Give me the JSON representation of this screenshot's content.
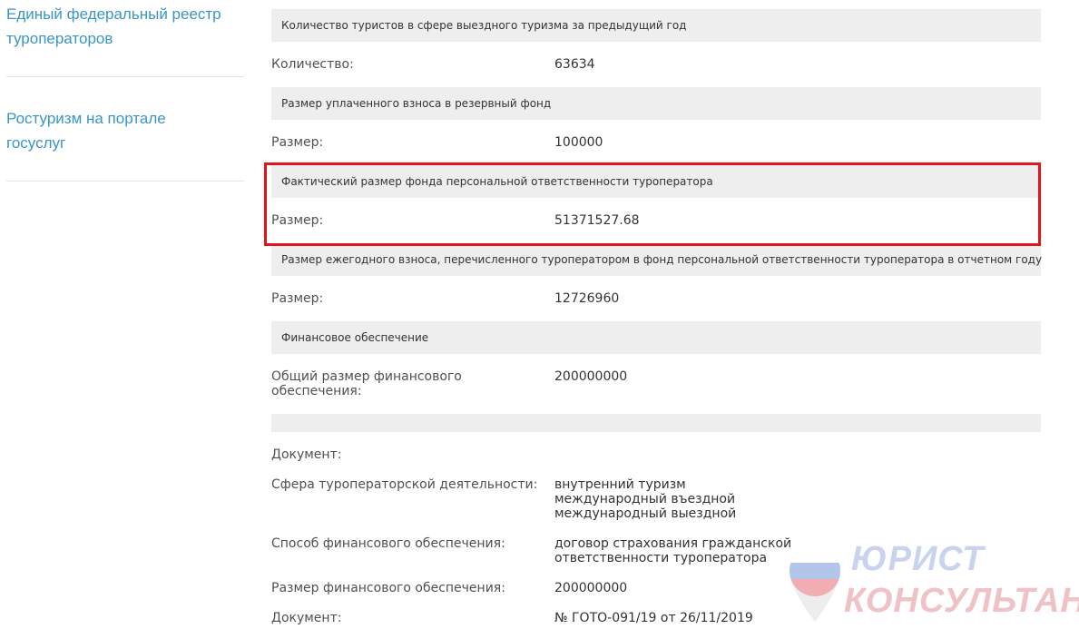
{
  "sidebar": {
    "links": [
      {
        "label": "Единый федеральный реестр туроператоров"
      },
      {
        "label": "Ростуризм на портале госуслуг"
      }
    ]
  },
  "sections": {
    "tourists": {
      "header": "Количество туристов в сфере выездного туризма за предыдущий год",
      "label": "Количество:",
      "value": "63634"
    },
    "reserve": {
      "header": "Размер уплаченного взноса в резервный фонд",
      "label": "Размер:",
      "value": "100000"
    },
    "fund_actual": {
      "header": "Фактический размер фонда персональной ответственности туроператора",
      "label": "Размер:",
      "value": "51371527.68"
    },
    "annual_contribution": {
      "header": "Размер ежегодного взноса, перечисленного туроператором в фонд персональной ответственности туроператора в отчетном году",
      "label": "Размер:",
      "value": "12726960"
    },
    "financial": {
      "header": "Финансовое обеспечение",
      "label_line1": "Общий размер финансового",
      "label_line2": "обеспечения:",
      "value": "200000000"
    },
    "details": {
      "document_label": "Документ:",
      "scope_label": "Сфера туроператорской деятельности:",
      "scope_values": [
        "внутренний туризм",
        "международный въездной",
        "международный выездной"
      ],
      "method_label": "Способ финансового обеспечения:",
      "method_value_line1": "договор страхования гражданской",
      "method_value_line2": "ответственности туроператора",
      "amount_label": "Размер финансового обеспечения:",
      "amount_value": "200000000",
      "doc_label": "Документ:",
      "doc_value": "№ ГОТО-091/19 от 26/11/2019"
    }
  },
  "watermark": {
    "line1": "ЮРИСТ",
    "line2": "КОНСУЛЬТАНТ"
  },
  "colors": {
    "link": "#3a95c5",
    "header_bg": "#eeeeee",
    "highlight": "#e0141b"
  }
}
